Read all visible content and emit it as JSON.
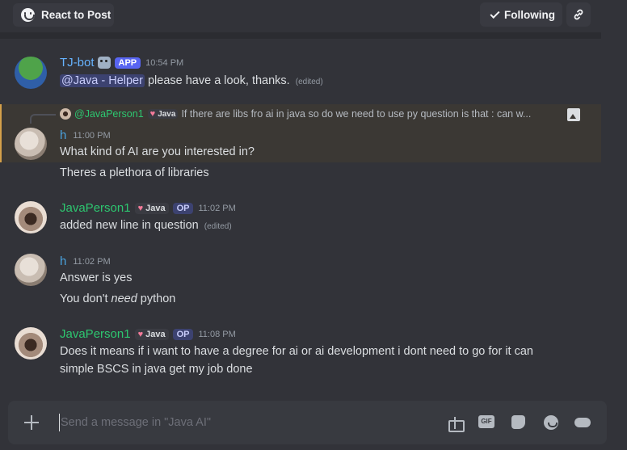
{
  "topbar": {
    "react_label": "React to Post",
    "following_label": "Following"
  },
  "messages": [
    {
      "author": "TJ-bot",
      "author_color": "#66b3ff",
      "tag": "APP",
      "time": "10:54 PM",
      "mention": "@Java - Helper",
      "text": "please have a look, thanks.",
      "edited": "(edited)"
    },
    {
      "reply": {
        "author": "@JavaPerson1",
        "role": "Java",
        "text": "If there are libs fro ai in java so do we need to use py question is that : can w..."
      },
      "author": "h",
      "author_color": "#4aa3df",
      "time": "11:00 PM",
      "lines": [
        "What kind of AI are you interested in?",
        "Theres a plethora of libraries"
      ]
    },
    {
      "author": "JavaPerson1",
      "author_color": "#2dc770",
      "role": "Java",
      "tag": "OP",
      "time": "11:02 PM",
      "text": "added new line in question",
      "edited": "(edited)"
    },
    {
      "author": "h",
      "author_color": "#4aa3df",
      "time": "11:02 PM",
      "lines": [
        "Answer is yes"
      ],
      "line2_prefix": "You don't ",
      "line2_italic": "need",
      "line2_suffix": " python"
    },
    {
      "author": "JavaPerson1",
      "author_color": "#2dc770",
      "role": "Java",
      "tag": "OP",
      "time": "11:08 PM",
      "lines": [
        "Does it means if i want to have a degree for ai or ai development i dont need to go for it can",
        "simple BSCS in java get my job done"
      ]
    }
  ],
  "composer": {
    "placeholder": "Send a message in \"Java AI\""
  },
  "icons": {
    "composer": [
      "plus-icon",
      "gift-icon",
      "gif-icon",
      "sticker-icon",
      "emoji-icon",
      "gamepad-icon"
    ]
  }
}
